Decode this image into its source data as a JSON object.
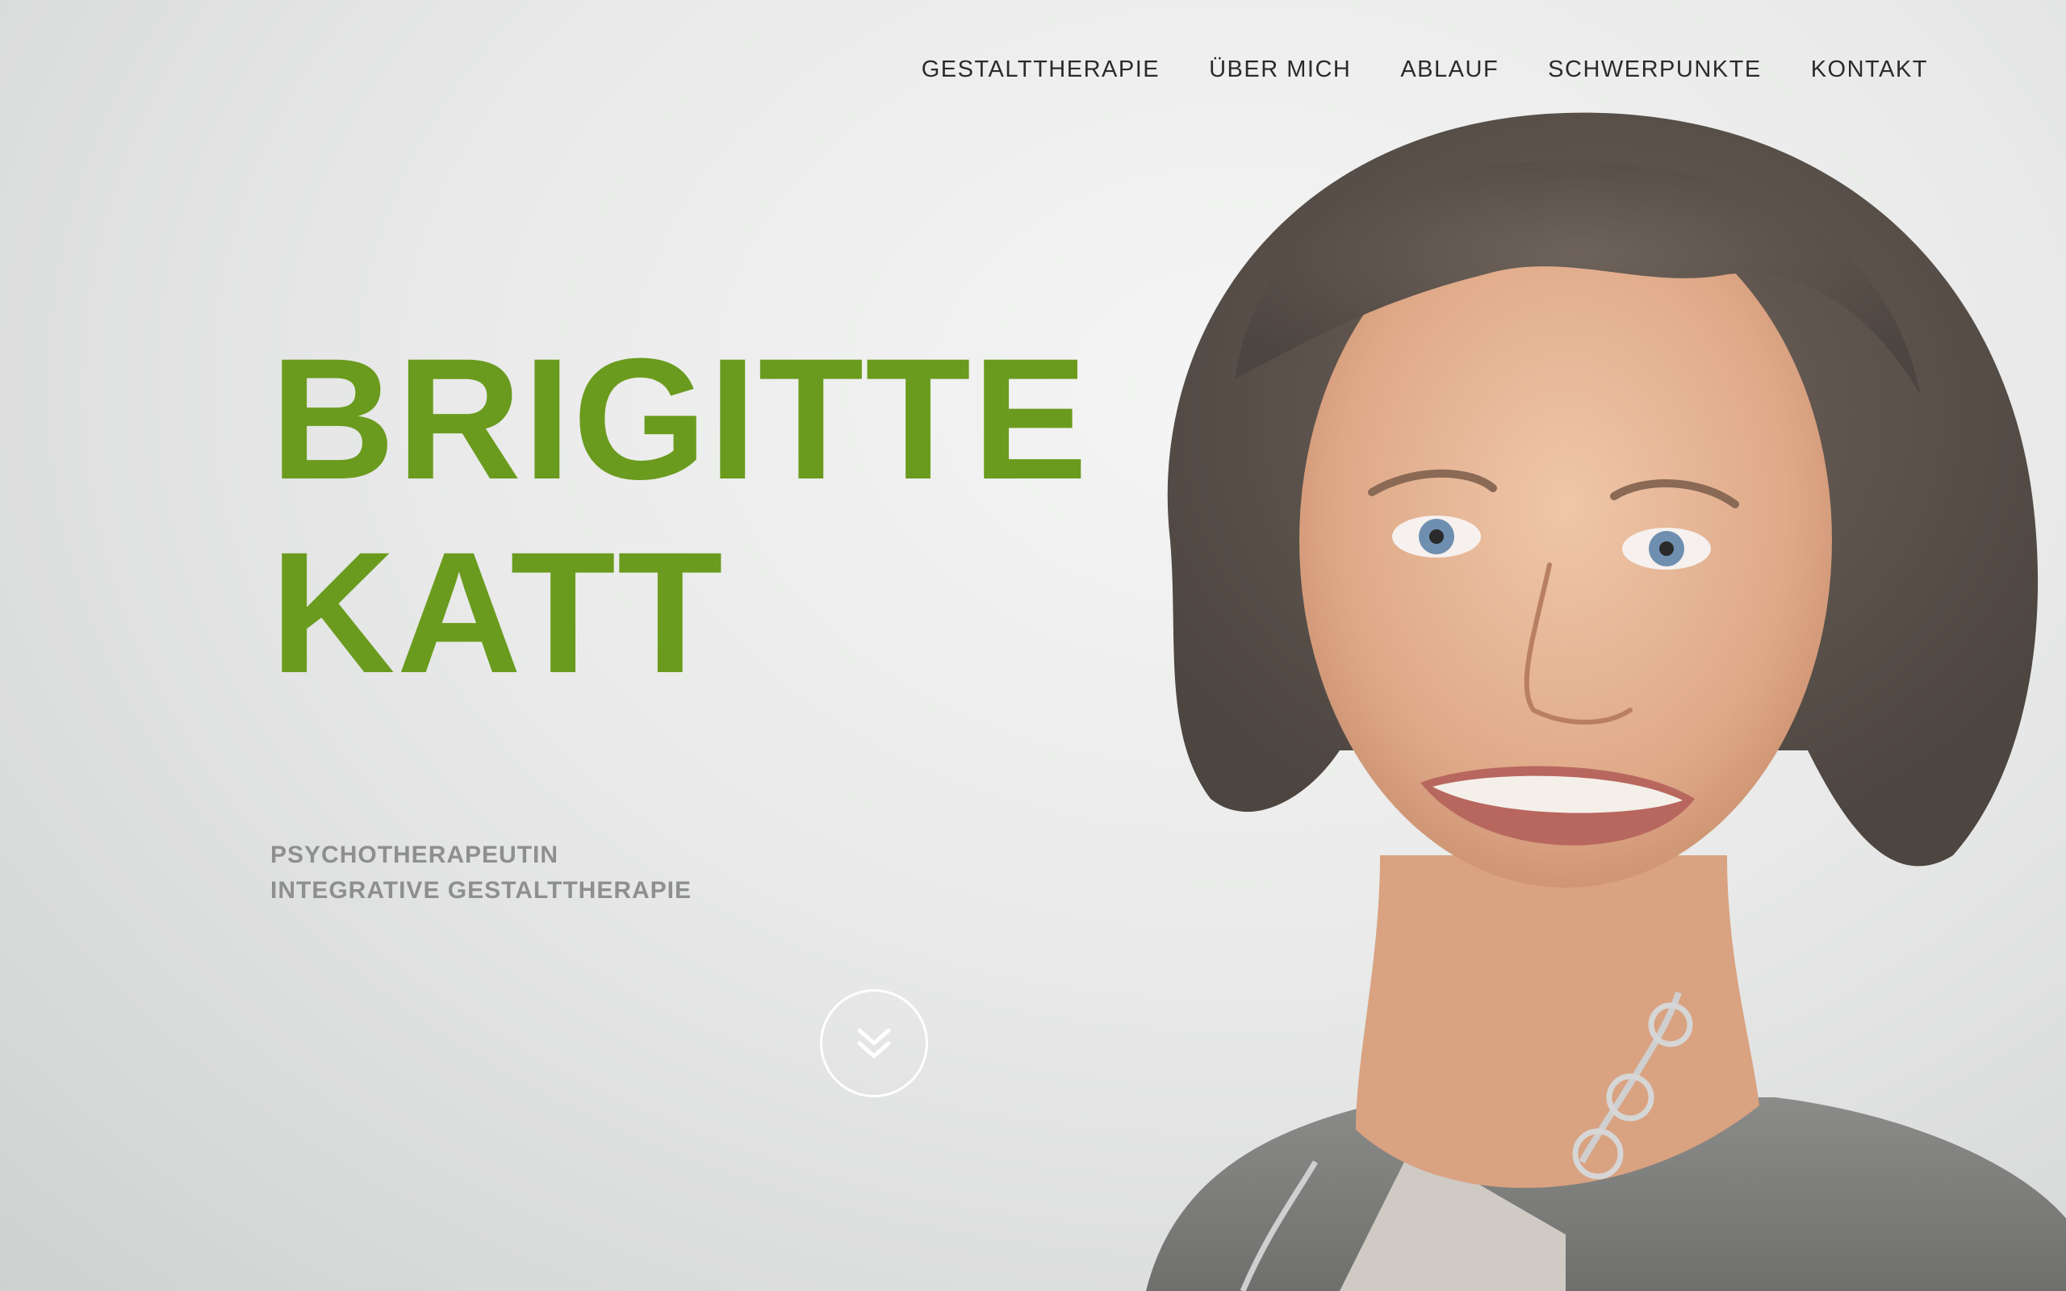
{
  "nav": {
    "items": [
      {
        "label": "GESTALTTHERAPIE"
      },
      {
        "label": "ÜBER MICH"
      },
      {
        "label": "ABLAUF"
      },
      {
        "label": "SCHWERPUNKTE"
      },
      {
        "label": "KONTAKT"
      }
    ]
  },
  "hero": {
    "first_name": "BRIGITTE",
    "last_name": "KATT",
    "subtitle_line1": "PSYCHOTHERAPEUTIN",
    "subtitle_line2": "INTEGRATIVE GESTALTTHERAPIE",
    "scroll_icon": "double-chevron-down-icon"
  },
  "colors": {
    "accent": "#6a9b1e",
    "subtitle": "#8e8f8f",
    "nav_text": "#2b2b2b",
    "background": "#e9eae9"
  }
}
